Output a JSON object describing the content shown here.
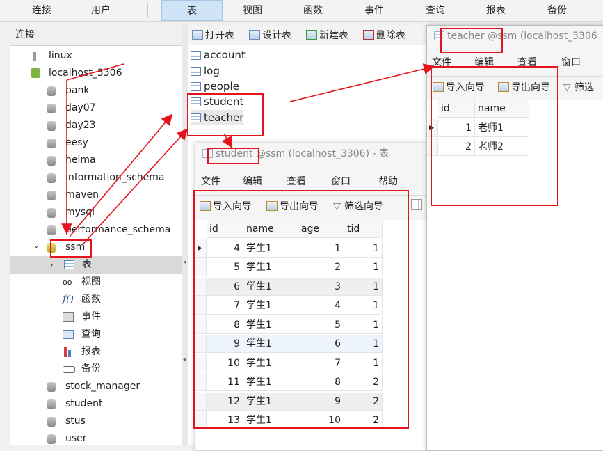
{
  "top_menu": [
    "连接",
    "用户",
    "表",
    "视图",
    "函数",
    "事件",
    "查询",
    "报表",
    "备份"
  ],
  "left_panel": {
    "header": "连接",
    "tree": [
      {
        "label": "linux",
        "type": "server"
      },
      {
        "label": "localhost_3306",
        "type": "server-open"
      },
      {
        "label": "bank",
        "type": "db"
      },
      {
        "label": "day07",
        "type": "db"
      },
      {
        "label": "day23",
        "type": "db"
      },
      {
        "label": "eesy",
        "type": "db"
      },
      {
        "label": "heima",
        "type": "db"
      },
      {
        "label": "information_schema",
        "type": "db"
      },
      {
        "label": "maven",
        "type": "db"
      },
      {
        "label": "mysql",
        "type": "db"
      },
      {
        "label": "performance_schema",
        "type": "db"
      },
      {
        "label": "ssm",
        "type": "db-open"
      },
      {
        "label": "表",
        "type": "tables"
      },
      {
        "label": "视图",
        "type": "views"
      },
      {
        "label": "函数",
        "type": "functions"
      },
      {
        "label": "事件",
        "type": "events"
      },
      {
        "label": "查询",
        "type": "queries"
      },
      {
        "label": "报表",
        "type": "reports"
      },
      {
        "label": "备份",
        "type": "backups"
      },
      {
        "label": "stock_manager",
        "type": "db"
      },
      {
        "label": "student",
        "type": "db"
      },
      {
        "label": "stus",
        "type": "db"
      },
      {
        "label": "user",
        "type": "db"
      }
    ]
  },
  "object_toolbar": {
    "open": "打开表",
    "design": "设计表",
    "new": "新建表",
    "delete": "删除表"
  },
  "object_list": [
    "account",
    "log",
    "people",
    "student",
    "teacher"
  ],
  "student_window": {
    "title": "student @ssm (localhost_3306) - 表",
    "menu": [
      "文件",
      "编辑",
      "查看",
      "窗口",
      "帮助"
    ],
    "toolbar": {
      "import": "导入向导",
      "export": "导出向导",
      "filter": "筛选向导"
    },
    "columns": [
      "id",
      "name",
      "age",
      "tid"
    ],
    "rows": [
      [
        "4",
        "学生1",
        "1",
        "1"
      ],
      [
        "5",
        "学生1",
        "2",
        "1"
      ],
      [
        "6",
        "学生1",
        "3",
        "1"
      ],
      [
        "7",
        "学生1",
        "4",
        "1"
      ],
      [
        "8",
        "学生1",
        "5",
        "1"
      ],
      [
        "9",
        "学生1",
        "6",
        "1"
      ],
      [
        "10",
        "学生1",
        "7",
        "1"
      ],
      [
        "11",
        "学生1",
        "8",
        "2"
      ],
      [
        "12",
        "学生1",
        "9",
        "2"
      ],
      [
        "13",
        "学生1",
        "10",
        "2"
      ]
    ]
  },
  "teacher_window": {
    "title": "teacher @ssm (localhost_3306",
    "menu": [
      "文件",
      "编辑",
      "查看",
      "窗口"
    ],
    "toolbar": {
      "import": "导入向导",
      "export": "导出向导",
      "filter": "筛选"
    },
    "columns": [
      "id",
      "name"
    ],
    "rows": [
      [
        "1",
        "老师1"
      ],
      [
        "2",
        "老师2"
      ]
    ]
  },
  "colors": {
    "annotation": "#e3141b",
    "selection": "#d9d9d9",
    "accent": "#cfe3f7"
  }
}
